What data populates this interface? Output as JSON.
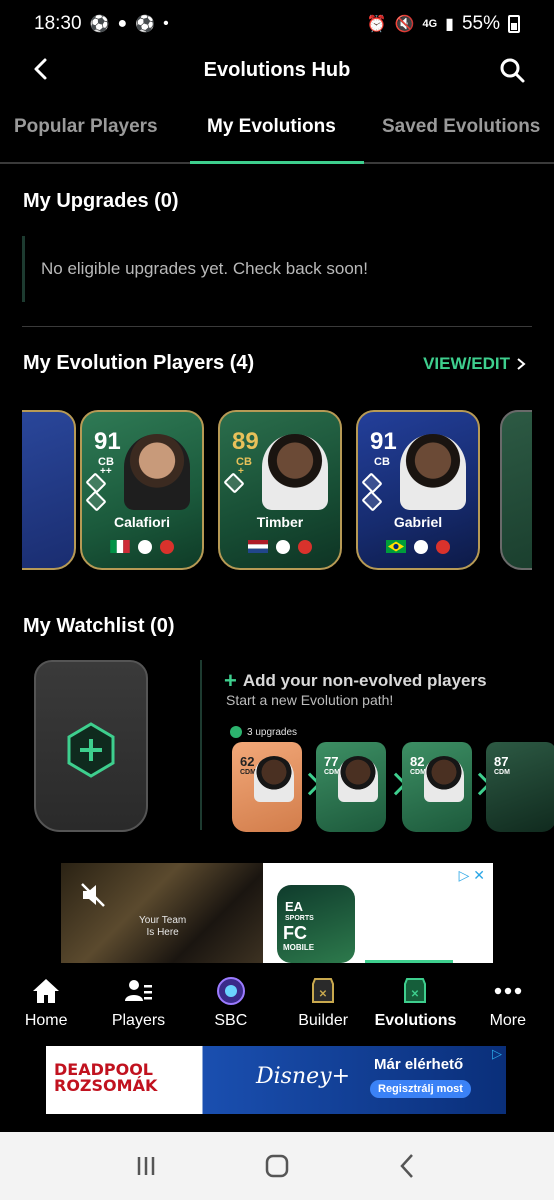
{
  "status_bar": {
    "time": "18:30",
    "network": "4G",
    "battery": "55%"
  },
  "header": {
    "title": "Evolutions Hub"
  },
  "tabs": [
    {
      "label": "Popular Players",
      "active": false
    },
    {
      "label": "My Evolutions",
      "active": true
    },
    {
      "label": "Saved Evolutions",
      "active": false
    }
  ],
  "upgrades": {
    "title": "My Upgrades (0)",
    "empty_text": "No eligible upgrades yet. Check back soon!"
  },
  "evolution_players": {
    "title": "My Evolution Players (4)",
    "view_edit": "VIEW/EDIT",
    "cards": [
      {
        "rating": "91",
        "position": "CB",
        "plus": "++",
        "name": "Calafiori",
        "nation": "Italy",
        "club": "Arsenal"
      },
      {
        "rating": "89",
        "position": "CB",
        "plus": "+",
        "name": "Timber",
        "nation": "Netherlands",
        "club": "Arsenal"
      },
      {
        "rating": "91",
        "position": "CB",
        "plus": "",
        "name": "Gabriel",
        "nation": "Brazil",
        "club": "Arsenal"
      }
    ]
  },
  "watchlist": {
    "title": "My Watchlist (0)",
    "add_text": "Add your non-evolved players",
    "sub_text": "Start a new Evolution path!",
    "upgrades_badge": "3 upgrades",
    "preview_cards": [
      {
        "rating": "62",
        "position": "CDM"
      },
      {
        "rating": "77",
        "position": "CDM"
      },
      {
        "rating": "82",
        "position": "CDM"
      },
      {
        "rating": "87",
        "position": "CDM"
      }
    ]
  },
  "ad_top": {
    "caption_line1": "Your Team",
    "caption_line2": "Is Here",
    "app_line1": "EA",
    "app_line2": "SPORTS",
    "app_name": "FC",
    "app_sub": "MOBILE"
  },
  "bottom_nav": [
    {
      "label": "Home",
      "icon": "home-icon",
      "active": false
    },
    {
      "label": "Players",
      "icon": "players-icon",
      "active": false
    },
    {
      "label": "SBC",
      "icon": "sbc-icon",
      "active": false
    },
    {
      "label": "Builder",
      "icon": "builder-icon",
      "active": false
    },
    {
      "label": "Evolutions",
      "icon": "evolutions-icon",
      "active": true
    },
    {
      "label": "More",
      "icon": "more-icon",
      "active": false
    }
  ],
  "ad_bottom": {
    "title_line1": "DEADPOOL",
    "title_line2": "ROZSOMÁK",
    "brand": "Disney+",
    "headline": "Már elérhető",
    "cta": "Regisztrálj most"
  },
  "colors": {
    "accent": "#3ecf8e",
    "background": "#000000",
    "card_border": "#b79a55"
  }
}
